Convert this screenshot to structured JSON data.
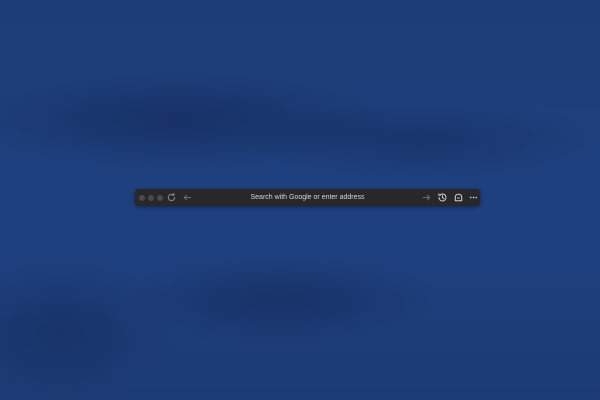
{
  "desktop": {
    "wallpaper_color": "#1f3f78"
  },
  "browser": {
    "toolbar_color": "#28282a",
    "traffic_lights": [
      "close",
      "minimize",
      "maximize"
    ],
    "icons": {
      "reload": "reload-icon",
      "back": "back-arrow-icon",
      "forward": "forward-arrow-icon",
      "history": "history-icon",
      "extension": "extension-icon",
      "more": "more-icon"
    },
    "address_bar": {
      "placeholder": "Search with Google or enter address"
    }
  }
}
